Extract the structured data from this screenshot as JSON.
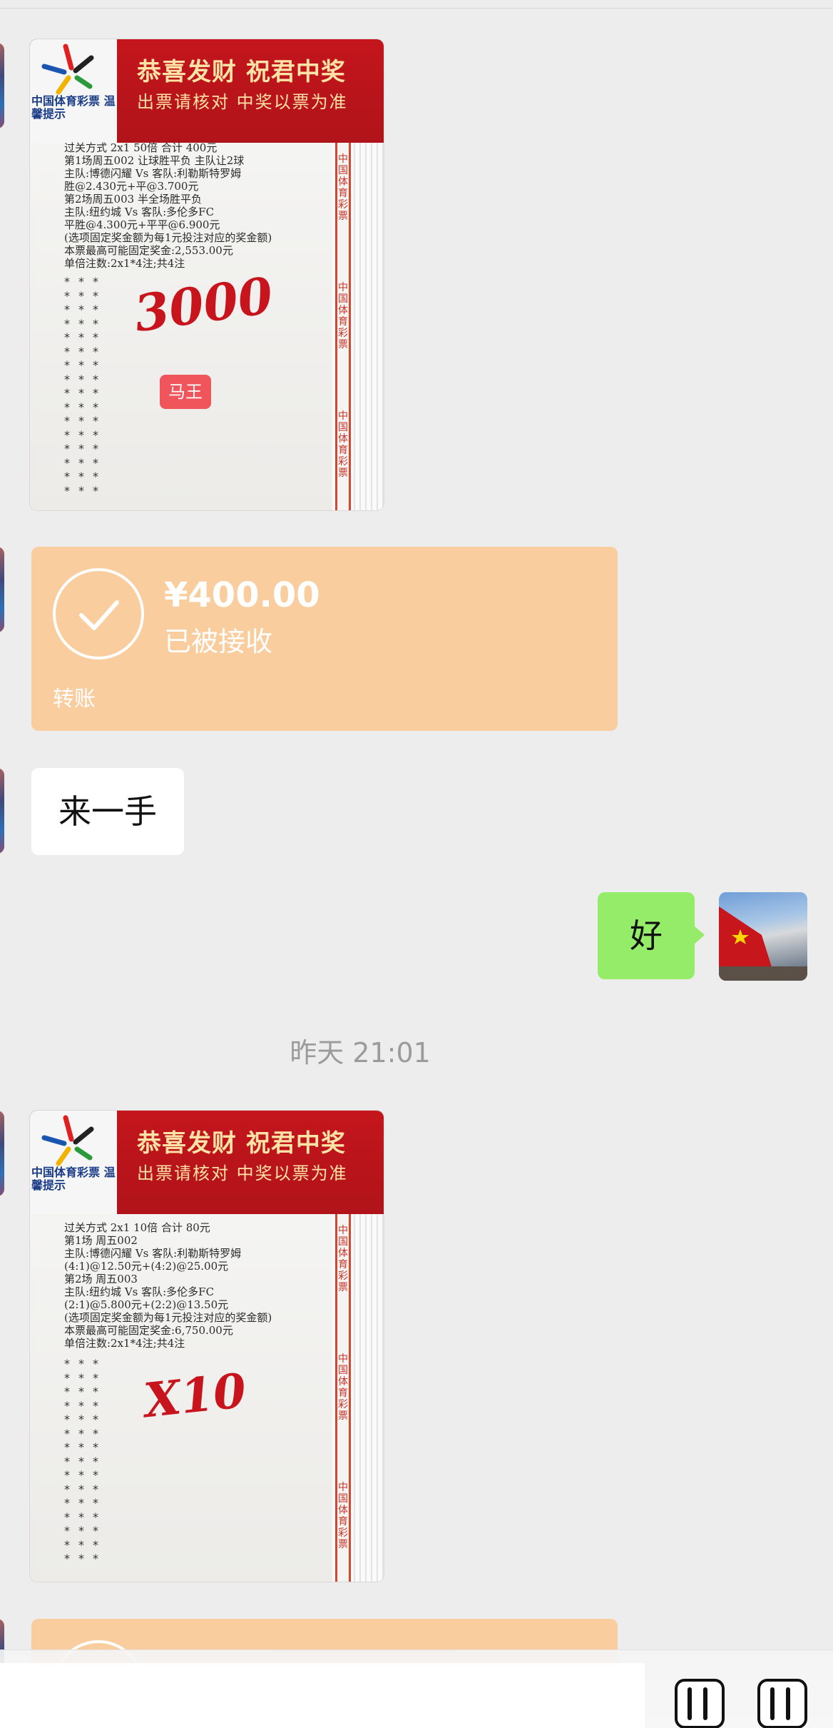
{
  "ticket1": {
    "slogan_top": "恭喜发财 祝君中奖",
    "slogan_sub": "出票请核对 中奖以票为准",
    "logo_text": "中国体育彩票 温馨提示",
    "lines": [
      "过关方式 2x1        50倍         合计 400元",
      "第1场周五002 让球胜平负   主队让2球",
      "主队:博德闪耀 Vs 客队:利勒斯特罗姆",
      "胜@2.430元+平@3.700元",
      "第2场周五003 半全场胜平负",
      "主队:纽约城 Vs 客队:多伦多FC",
      "平胜@4.300元+平平@6.900元",
      "(选项固定奖金额为每1元投注对应的奖金额)",
      "本票最高可能固定奖金:2,553.00元",
      "单倍注数:2x1*4注;共4注"
    ],
    "handwriting": "3000",
    "tag": "马王",
    "stripe_text": "中国体育彩票"
  },
  "transfer": {
    "amount": "¥400.00",
    "status": "已被接收",
    "kind": "转账"
  },
  "message_in": "来一手",
  "message_out": "好",
  "timestamp": "昨天 21:01",
  "ticket2": {
    "slogan_top": "恭喜发财 祝君中奖",
    "slogan_sub": "出票请核对 中奖以票为准",
    "logo_text": "中国体育彩票 温馨提示",
    "lines": [
      "过关方式 2x1        10倍         合计 80元",
      "第1场  周五002",
      "主队:博德闪耀 Vs 客队:利勒斯特罗姆",
      "(4:1)@12.50元+(4:2)@25.00元",
      "第2场  周五003",
      "主队:纽约城 Vs 客队:多伦多FC",
      "(2:1)@5.800元+(2:2)@13.50元",
      "(选项固定奖金额为每1元投注对应的奖金额)",
      "本票最高可能固定奖金:6,750.00元",
      "单倍注数:2x1*4注;共4注"
    ],
    "handwriting": "X10",
    "stripe_text": "中国体育彩票"
  },
  "colors": {
    "background": "#ededed",
    "transfer_bubble": "#f9cd9e",
    "outgoing_bubble": "#95ec69",
    "ticket_red": "#c4151c"
  },
  "icons": [
    "check-circle-icon",
    "voice-icon",
    "emoji-icon"
  ]
}
